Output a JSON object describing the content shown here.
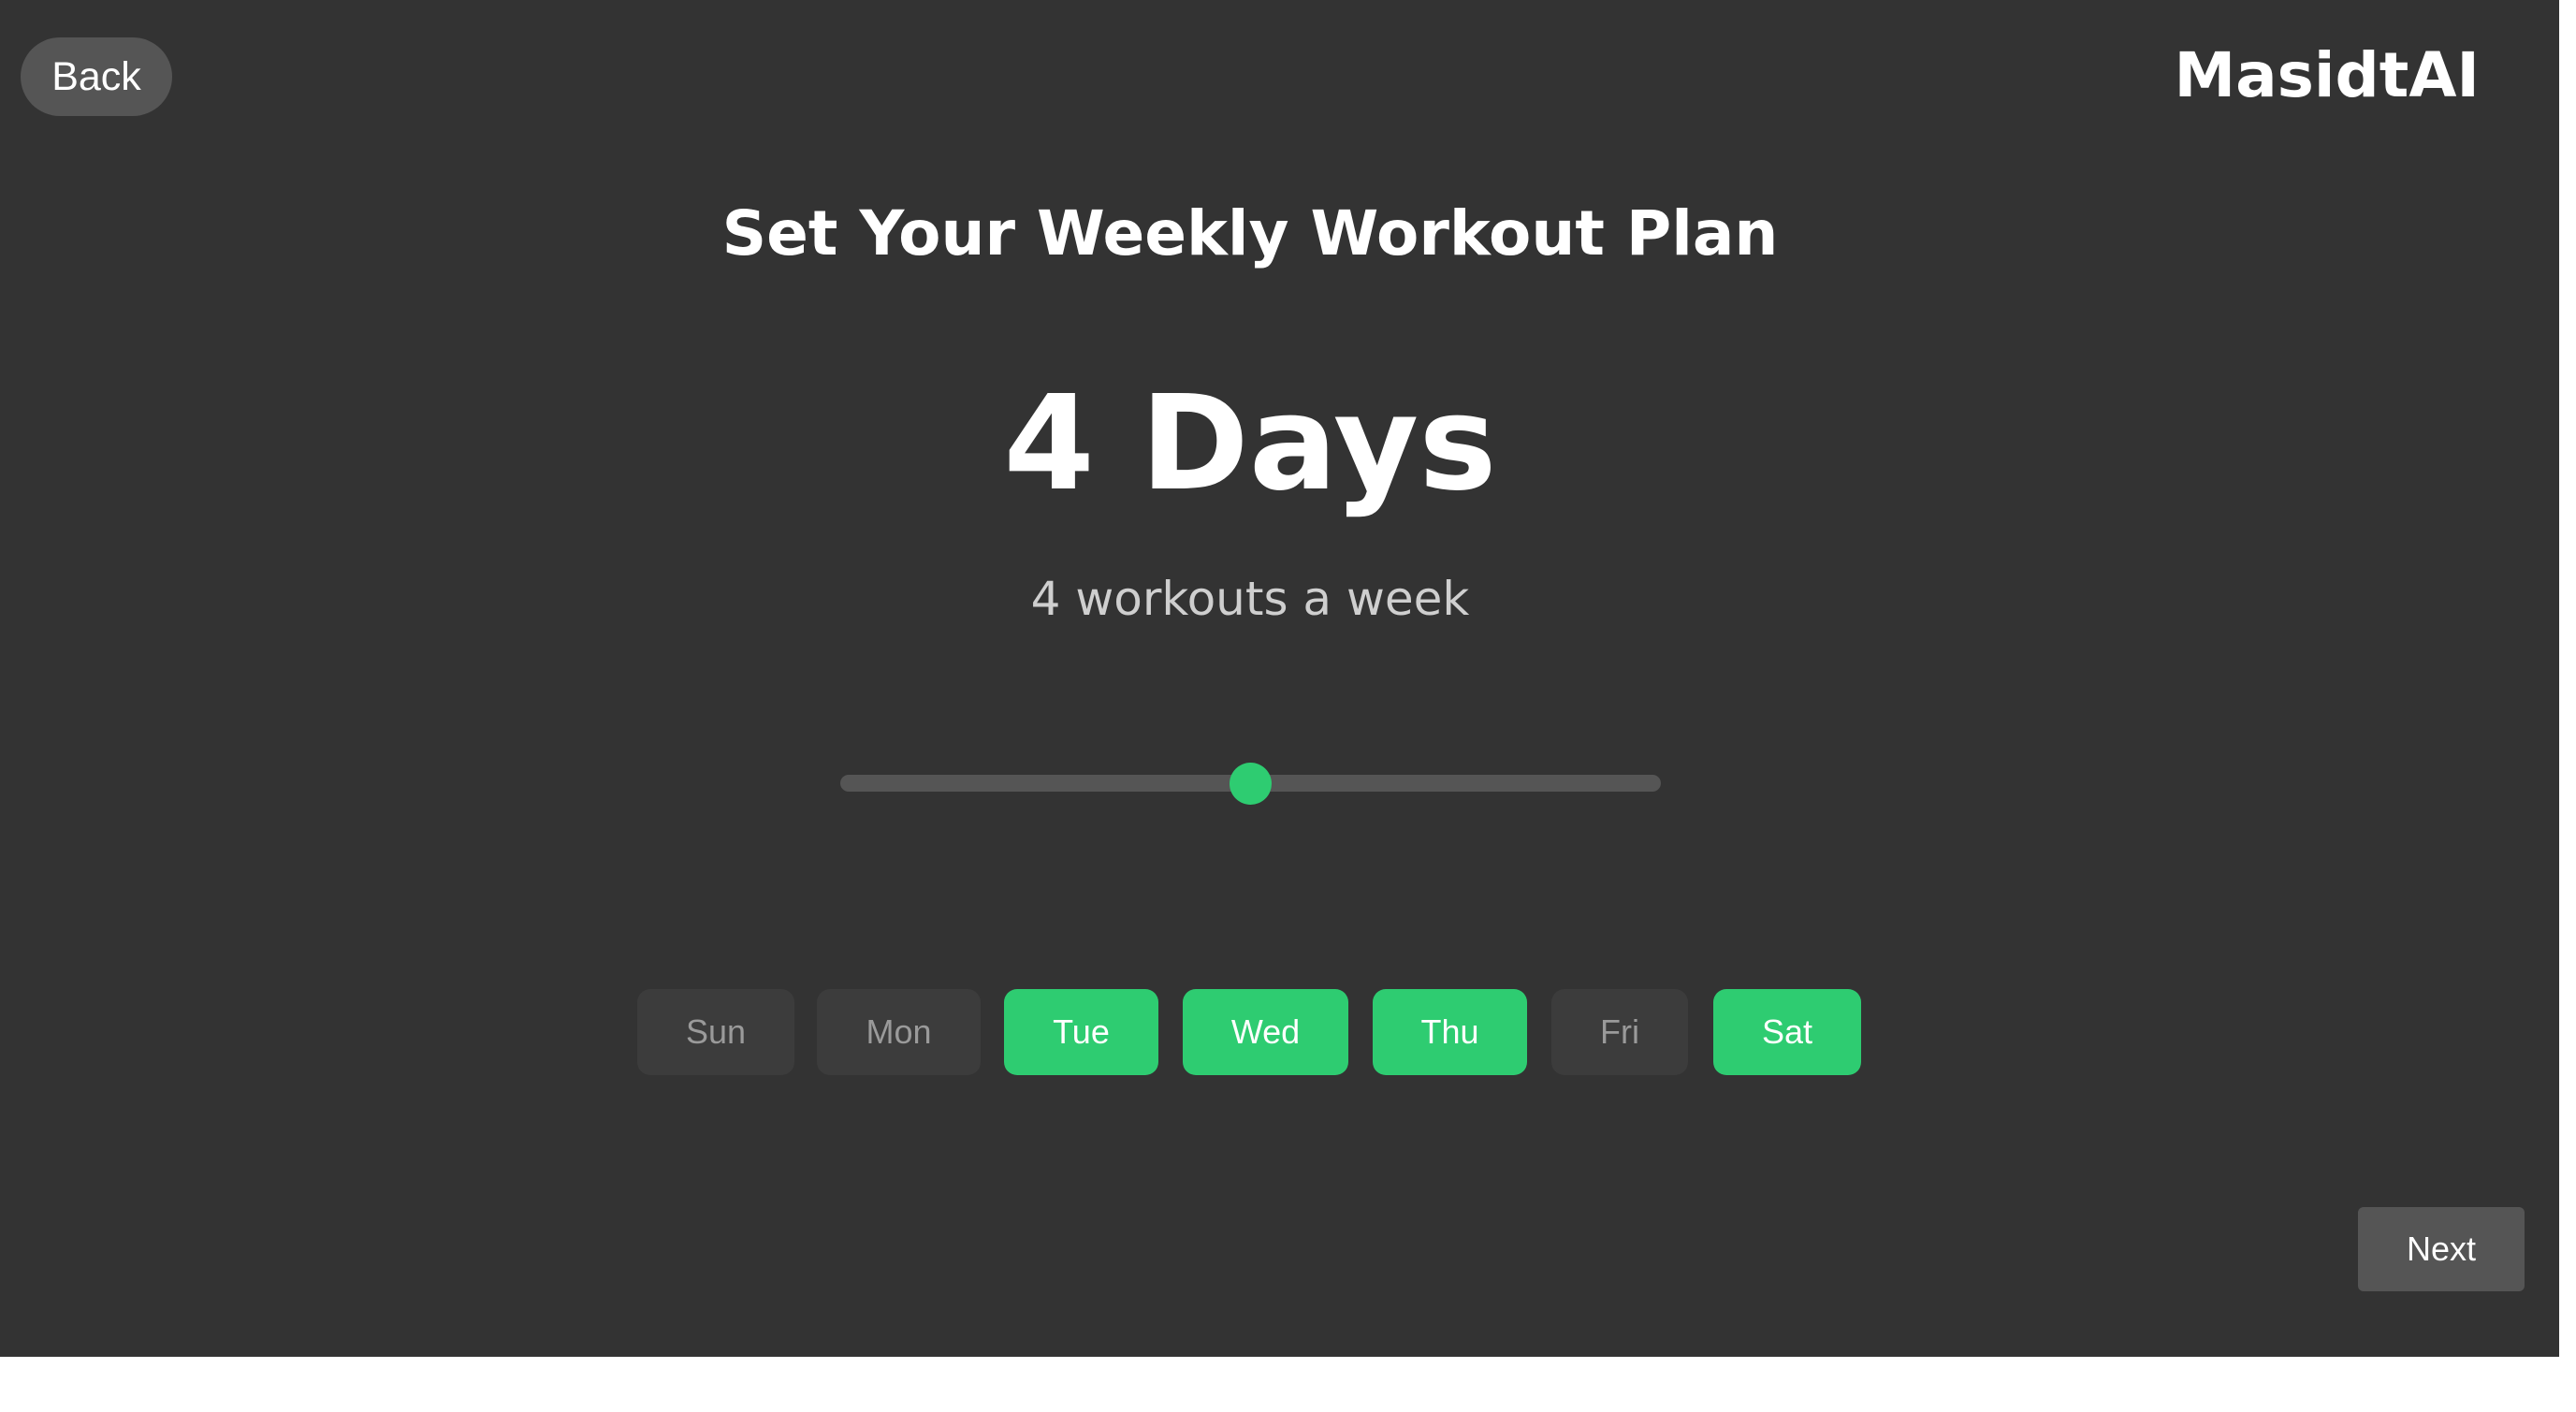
{
  "header": {
    "back_label": "Back",
    "brand": "MasidtAI"
  },
  "main": {
    "title": "Set Your Weekly Workout Plan",
    "days_count_label": "4 Days",
    "workouts_label": "4 workouts a week",
    "slider": {
      "value": 4,
      "fraction": 0.5
    },
    "days": [
      {
        "label": "Sun",
        "selected": false
      },
      {
        "label": "Mon",
        "selected": false
      },
      {
        "label": "Tue",
        "selected": true
      },
      {
        "label": "Wed",
        "selected": true
      },
      {
        "label": "Thu",
        "selected": true
      },
      {
        "label": "Fri",
        "selected": false
      },
      {
        "label": "Sat",
        "selected": true
      }
    ]
  },
  "footer": {
    "next_label": "Next"
  },
  "colors": {
    "background": "#333333",
    "accent": "#2ecc71",
    "button_gray": "#555555",
    "day_off": "#3c3c3c"
  }
}
